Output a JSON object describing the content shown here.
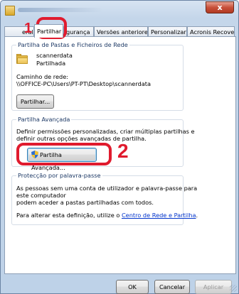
{
  "window": {
    "title": "",
    "close_label": "x"
  },
  "tabs": [
    {
      "label": "Geral",
      "display": "eral"
    },
    {
      "label": "Partilhar"
    },
    {
      "label": "Segurança",
      "display": "gurança"
    },
    {
      "label": "Versões anteriores"
    },
    {
      "label": "Personalizar"
    },
    {
      "label": "Acronis Recovery"
    }
  ],
  "network_sharing": {
    "title": "Partilha de Pastas e Ficheiros de Rede",
    "folder_name": "scannerdata",
    "folder_status": "Partilhada",
    "network_path_label": "Caminho de rede:",
    "network_path": "\\\\OFFICE-PC\\Users\\PT-PT\\Desktop\\scannerdata",
    "share_button": "Partilhar..."
  },
  "advanced_sharing": {
    "title": "Partilha Avançada",
    "description_line1": "Definir permissões personalizadas, criar múltiplas partilhas e",
    "description_line2": "definir outras opções avançadas de partilha.",
    "button": "Partilha Avançada..."
  },
  "password_protection": {
    "title": "Protecção por palavra-passe",
    "line1": "As pessoas sem uma conta de utilizador e palavra-passe para",
    "line2": "este computador",
    "line3": "podem aceder a pastas partilhadas com todos.",
    "change_text": "Para alterar esta definição, utilize o",
    "link": "Centro de Rede e Partilha",
    "period": "."
  },
  "footer": {
    "ok": "OK",
    "cancel": "Cancelar",
    "apply": "Aplicar"
  },
  "annotations": {
    "step1": "1",
    "step2": "2",
    "color": "#e01b2e"
  }
}
